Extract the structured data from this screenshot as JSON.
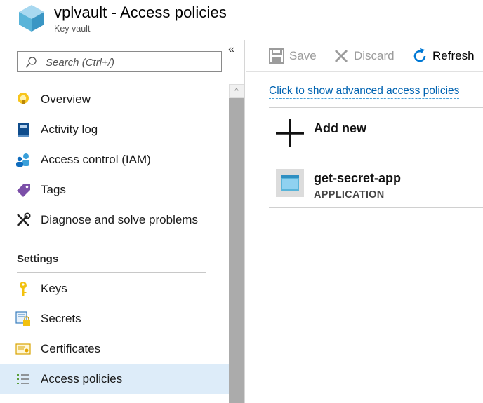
{
  "header": {
    "title": "vplvault - Access policies",
    "subtitle": "Key vault"
  },
  "sidebar": {
    "search_placeholder": "Search (Ctrl+/)",
    "collapse_glyph": "«",
    "scroll_up_glyph": "^",
    "items": [
      {
        "label": "Overview",
        "icon": "lightbulb-icon"
      },
      {
        "label": "Activity log",
        "icon": "book-icon"
      },
      {
        "label": "Access control (IAM)",
        "icon": "people-icon"
      },
      {
        "label": "Tags",
        "icon": "tag-icon"
      },
      {
        "label": "Diagnose and solve problems",
        "icon": "wrench-icon"
      }
    ],
    "settings_heading": "Settings",
    "settings_items": [
      {
        "label": "Keys",
        "icon": "key-icon"
      },
      {
        "label": "Secrets",
        "icon": "secret-icon"
      },
      {
        "label": "Certificates",
        "icon": "certificate-icon"
      },
      {
        "label": "Access policies",
        "icon": "list-icon",
        "active": true
      }
    ]
  },
  "toolbar": {
    "save_label": "Save",
    "discard_label": "Discard",
    "refresh_label": "Refresh"
  },
  "main": {
    "advanced_link": "Click to show advanced access policies",
    "add_new_label": "Add new",
    "policies": [
      {
        "name": "get-secret-app",
        "type": "APPLICATION"
      }
    ]
  },
  "colors": {
    "accent": "#0078d4",
    "link": "#0063b1",
    "active_nav": "#ddecf9",
    "disabled_text": "#9c9c9c"
  }
}
